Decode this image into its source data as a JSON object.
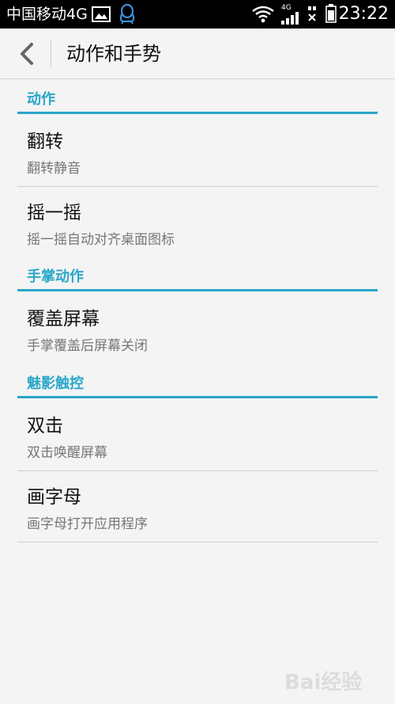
{
  "status_bar": {
    "carrier": "中国移动4G",
    "network_label": "4G",
    "time": "23:22",
    "colors": {
      "background": "#000000",
      "text": "#ffffff"
    }
  },
  "app_bar": {
    "title": "动作和手势"
  },
  "sections": [
    {
      "header": "动作",
      "items": [
        {
          "title": "翻转",
          "subtitle": "翻转静音"
        },
        {
          "title": "摇一摇",
          "subtitle": "摇一摇自动对齐桌面图标"
        }
      ]
    },
    {
      "header": "手掌动作",
      "items": [
        {
          "title": "覆盖屏幕",
          "subtitle": "手掌覆盖后屏幕关闭"
        }
      ]
    },
    {
      "header": "魅影触控",
      "items": [
        {
          "title": "双击",
          "subtitle": "双击唤醒屏幕"
        },
        {
          "title": "画字母",
          "subtitle": "画字母打开应用程序"
        }
      ]
    }
  ],
  "watermark": {
    "text": "Bai经验"
  },
  "colors": {
    "accent": "#2aa7c8",
    "background": "#f4f4f4",
    "divider": "#cfcfcf"
  }
}
